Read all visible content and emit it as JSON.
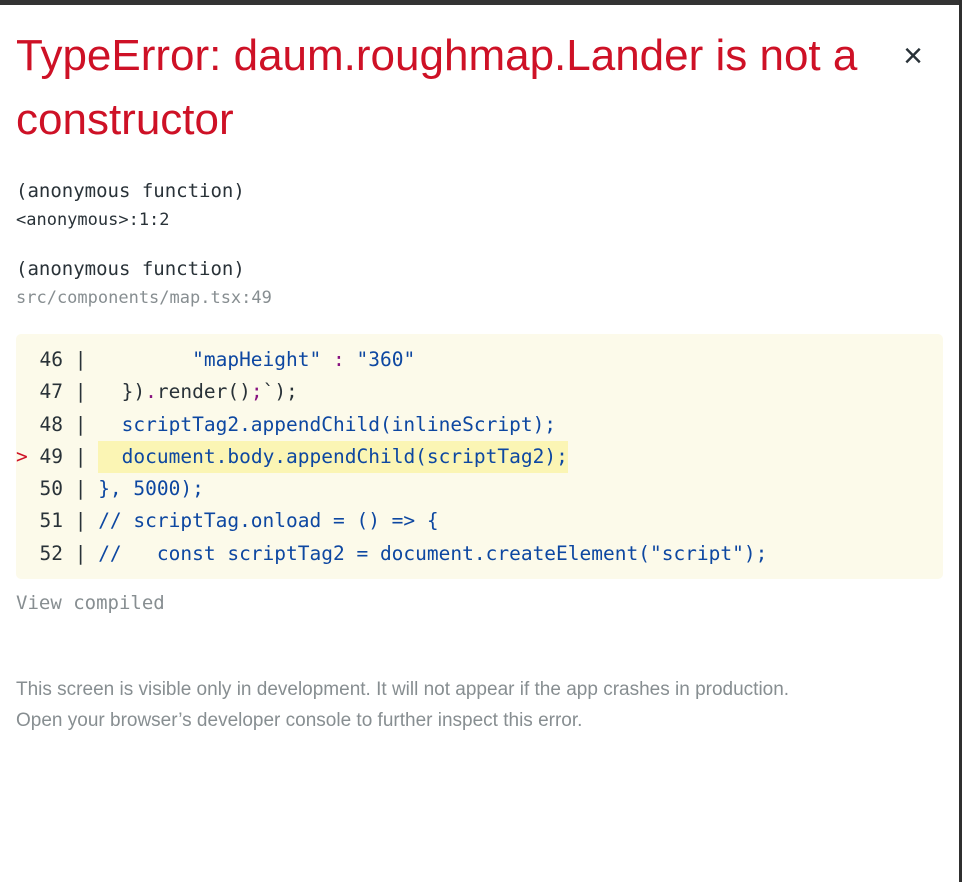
{
  "error": {
    "title": "TypeError: daum.roughmap.Lander is not a constructor",
    "close_glyph": "×"
  },
  "frames": [
    {
      "function": "(anonymous function)",
      "location": "<anonymous>:1:2"
    },
    {
      "function": "(anonymous function)",
      "location": "src/components/map.tsx:49"
    }
  ],
  "code_snippet": {
    "highlighted_line": 49,
    "lines": [
      {
        "gutter": "  46 | ",
        "highlighted": false,
        "tokens": [
          {
            "text": "        ",
            "kind": "plain"
          },
          {
            "text": "\"mapHeight\"",
            "kind": "blue"
          },
          {
            "text": " ",
            "kind": "plain"
          },
          {
            "text": ":",
            "kind": "magenta"
          },
          {
            "text": " ",
            "kind": "plain"
          },
          {
            "text": "\"360\"",
            "kind": "blue"
          }
        ]
      },
      {
        "gutter": "  47 | ",
        "highlighted": false,
        "tokens": [
          {
            "text": "  })",
            "kind": "dark"
          },
          {
            "text": ".",
            "kind": "magenta"
          },
          {
            "text": "render()",
            "kind": "dark"
          },
          {
            "text": ";",
            "kind": "magenta"
          },
          {
            "text": "`);",
            "kind": "dark"
          }
        ]
      },
      {
        "gutter": "  48 | ",
        "highlighted": false,
        "tokens": [
          {
            "text": "  scriptTag2.appendChild(inlineScript);",
            "kind": "blue"
          }
        ]
      },
      {
        "gutter": "> 49 | ",
        "highlighted": true,
        "tokens": [
          {
            "text": "  document.body.appendChild(scriptTag2);",
            "kind": "blue"
          }
        ]
      },
      {
        "gutter": "  50 | ",
        "highlighted": false,
        "tokens": [
          {
            "text": "}, 5000);",
            "kind": "blue"
          }
        ]
      },
      {
        "gutter": "  51 | ",
        "highlighted": false,
        "tokens": [
          {
            "text": "// scriptTag.onload = () => {",
            "kind": "blue"
          }
        ]
      },
      {
        "gutter": "  52 | ",
        "highlighted": false,
        "tokens": [
          {
            "text": "//   const scriptTag2 = document.createElement(\"script\");",
            "kind": "blue"
          }
        ]
      }
    ]
  },
  "view_compiled_label": "View compiled",
  "footer": {
    "line1": "This screen is visible only in development. It will not appear if the app crashes in production.",
    "line2": "Open your browser’s developer console to further inspect this error."
  },
  "colors": {
    "error_red": "#ce1126",
    "code_background": "#fcfaea",
    "highlight_background": "#fbf5b4",
    "code_blue": "#0d47a1",
    "code_magenta": "#881280",
    "muted_grey": "#878e91"
  }
}
